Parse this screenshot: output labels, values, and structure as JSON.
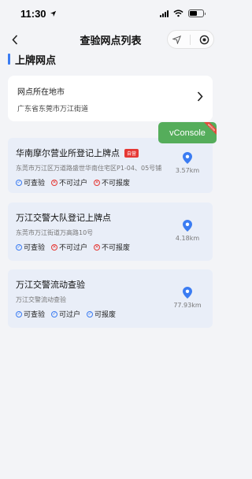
{
  "status_bar": {
    "time": "11:30"
  },
  "nav": {
    "title": "查验网点列表"
  },
  "section": {
    "title": "上牌网点"
  },
  "location": {
    "label": "网点所在地市",
    "value": "广东省东莞市万江街道"
  },
  "vconsole": {
    "label": "vConsole",
    "corner_text": "weinre"
  },
  "outlets": [
    {
      "name": "华南摩尔营业所登记上牌点",
      "badge": "自营",
      "address": "东莞市万江区万道路盛世华南住宅区P1-04、05号铺",
      "distance": "3.57km",
      "services": [
        {
          "label": "可查验",
          "available": true
        },
        {
          "label": "不可过户",
          "available": false
        },
        {
          "label": "不可报废",
          "available": false
        }
      ]
    },
    {
      "name": "万江交警大队登记上牌点",
      "address": "东莞市万江街道万高路10号",
      "distance": "4.18km",
      "services": [
        {
          "label": "可查验",
          "available": true
        },
        {
          "label": "不可过户",
          "available": false
        },
        {
          "label": "不可报废",
          "available": false
        }
      ]
    },
    {
      "name": "万江交警流动查验",
      "address": "万江交警流动查验",
      "distance": "77.93km",
      "services": [
        {
          "label": "可查验",
          "available": true
        },
        {
          "label": "可过户",
          "available": true
        },
        {
          "label": "可报废",
          "available": true
        }
      ]
    }
  ],
  "colors": {
    "accent": "#3b7cf2",
    "unavailable": "#e53935",
    "card_bg": "#e9eef8",
    "vconsole": "#55ad5b"
  }
}
